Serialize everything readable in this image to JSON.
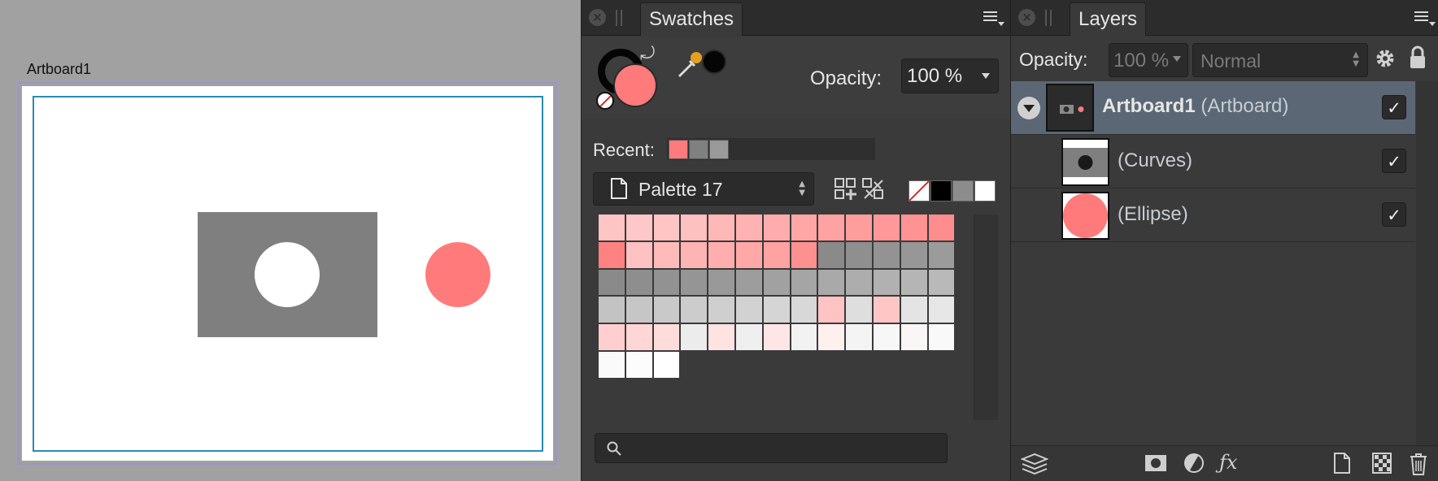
{
  "canvas": {
    "artboard_label": "Artboard1",
    "colors": {
      "background": "#a1a1a1",
      "guide": "#2c8ab5",
      "selection": "#9b96c3",
      "gray_rect": "#7f7f7f",
      "pink_circle": "#ff7b7b"
    }
  },
  "swatches_panel": {
    "tab_label": "Swatches",
    "fill_color": "#ff7b7b",
    "stroke_color": "#050505",
    "picker_color": "#050505",
    "opacity_label": "Opacity:",
    "opacity_value": "100 %",
    "recent_label": "Recent:",
    "recent": [
      "#ff7b7b",
      "#808080",
      "#9a9a9a"
    ],
    "palette_name": "Palette 17",
    "bw_swatches": [
      "none",
      "#000000",
      "#8c8c8c",
      "#ffffff"
    ],
    "grid": [
      "#ffc5c5",
      "#ffc8c8",
      "#ffc5c5",
      "#ffc0c0",
      "#ffb8b8",
      "#ffb2b2",
      "#ffacac",
      "#ffa7a7",
      "#ffa2a2",
      "#ff9d9d",
      "#ff9898",
      "#ff9393",
      "#ff8d8d",
      "#ff8282",
      "#ffc1c1",
      "#ffbaba",
      "#ffb4b4",
      "#ffaeae",
      "#ffa8a8",
      "#ffa2a2",
      "#ff9090",
      "#8a8a8a",
      "#8f8f8f",
      "#939393",
      "#979797",
      "#9b9b9b",
      "#8a8a8a",
      "#8e8e8e",
      "#929292",
      "#959595",
      "#999999",
      "#9d9d9d",
      "#a1a1a1",
      "#a5a5a5",
      "#a9a9a9",
      "#adadad",
      "#b1b1b1",
      "#b5b5b5",
      "#b9b9b9",
      "#c3c3c3",
      "#c6c6c6",
      "#c9c9c9",
      "#cccccc",
      "#cfcfcf",
      "#d2d2d2",
      "#d5d5d5",
      "#d8d8d8",
      "#ffc3c3",
      "#dedede",
      "#ffc6c6",
      "#e4e4e4",
      "#e7e7e7",
      "#ffcfcf",
      "#ffd6d6",
      "#ffdcdc",
      "#ececec",
      "#ffe2e2",
      "#efefef",
      "#ffe6e6",
      "#f2f2f2",
      "#fff0f0",
      "#f4f4f4",
      "#f7f7f7",
      "#fbf6f6",
      "#f9f9f9",
      "#fafafa",
      "#fcfcfc",
      "#ffffff"
    ],
    "search_placeholder": ""
  },
  "layers_panel": {
    "tab_label": "Layers",
    "opacity_label": "Opacity:",
    "opacity_value": "100 %",
    "blend_mode": "Normal",
    "layers": [
      {
        "name": "Artboard1",
        "type": "(Artboard)",
        "visible": "✓",
        "selected": true
      },
      {
        "name": "",
        "type": "(Curves)",
        "visible": "✓",
        "selected": false
      },
      {
        "name": "",
        "type": "(Ellipse)",
        "visible": "✓",
        "selected": false
      }
    ]
  },
  "icons": [
    "close-icon",
    "panel-menu-icon",
    "swap-icon",
    "none-color-icon",
    "color-picker-icon",
    "document-icon",
    "add-swatch-icon",
    "remove-swatch-icon",
    "search-icon",
    "gear-icon",
    "lock-icon",
    "collapse-icon",
    "layers-stack-icon",
    "mask-icon",
    "adjustment-icon",
    "fx-icon",
    "new-layer-icon",
    "pixel-layer-icon",
    "trash-icon"
  ]
}
